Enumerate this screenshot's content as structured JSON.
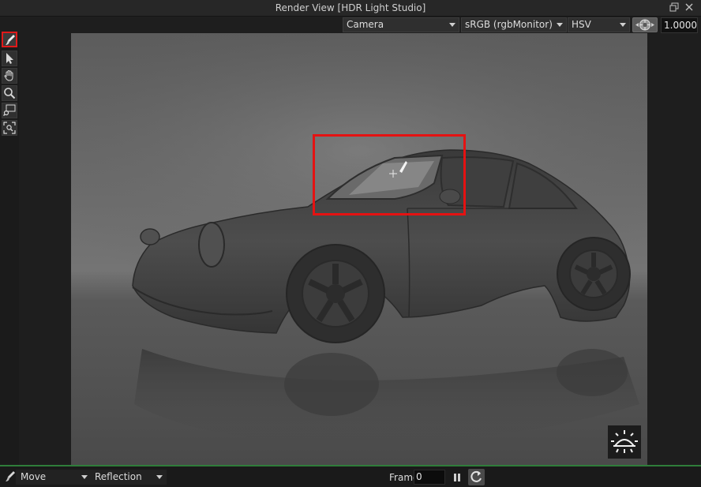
{
  "window": {
    "title": "Render View [HDR Light Studio]"
  },
  "toolbar": {
    "camera": "Camera",
    "colorspace": "sRGB (rgbMonitor)",
    "mode": "HSV",
    "exposure": "1.0000"
  },
  "tools": [
    "paint-brush-icon",
    "pointer-icon",
    "hand-pan-icon",
    "zoom-icon",
    "zoom-region-icon",
    "fit-view-icon"
  ],
  "statusbar": {
    "placement_mode": "Move",
    "light_type": "Reflection",
    "frame_label": "Frame",
    "frame_value": "0"
  },
  "colors": {
    "selection": "#e51212",
    "status_accent": "#2f7d3a",
    "background_panel": "#1e1e1e"
  }
}
